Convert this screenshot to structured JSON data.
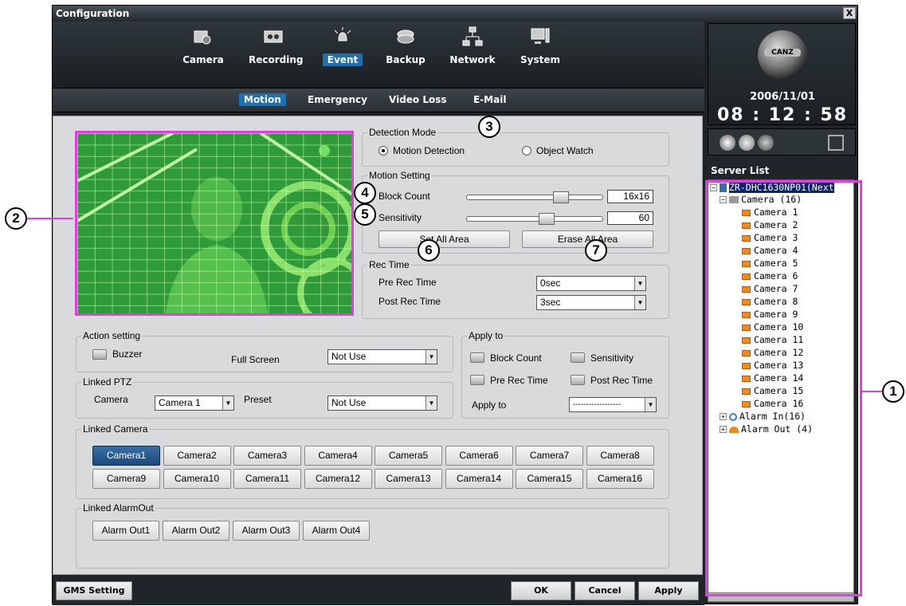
{
  "window": {
    "title": "Configuration",
    "close": "X"
  },
  "nav": {
    "items": [
      {
        "label": "Camera",
        "icon": "camera-icon"
      },
      {
        "label": "Recording",
        "icon": "recorder-icon"
      },
      {
        "label": "Event",
        "icon": "alarm-bell-icon"
      },
      {
        "label": "Backup",
        "icon": "disc-icon"
      },
      {
        "label": "Network",
        "icon": "network-icon"
      },
      {
        "label": "System",
        "icon": "monitor-icon"
      }
    ],
    "active": "Event"
  },
  "subnav": {
    "items": [
      "Motion",
      "Emergency",
      "Video Loss",
      "E-Mail"
    ],
    "active": "Motion"
  },
  "brand": {
    "logo": "CANZ",
    "date": "2006/11/01",
    "time": "08 : 12 : 58"
  },
  "server_list": {
    "header": "Server List",
    "root": "ZR-DHC1630NP01(Next",
    "camera_group": "Camera (16)",
    "cameras": [
      "Camera 1",
      "Camera 2",
      "Camera 3",
      "Camera 4",
      "Camera 5",
      "Camera 6",
      "Camera 7",
      "Camera 8",
      "Camera 9",
      "Camera 10",
      "Camera 11",
      "Camera 12",
      "Camera 13",
      "Camera 14",
      "Camera 15",
      "Camera 16"
    ],
    "alarm_in": "Alarm In(16)",
    "alarm_out": "Alarm Out (4)"
  },
  "detection_mode": {
    "label": "Detection Mode",
    "option1": "Motion Detection",
    "option2": "Object Watch",
    "selected": "Motion Detection"
  },
  "motion_setting": {
    "label": "Motion Setting",
    "block_count_label": "Block Count",
    "block_count_value": "16x16",
    "block_count_level": 0.72,
    "sensitivity_label": "Sensitivity",
    "sensitivity_value": "60",
    "sensitivity_level": 0.6,
    "set_all": "Set All Area",
    "erase_all": "Erase All Area"
  },
  "rec_time": {
    "label": "Rec Time",
    "pre_label": "Pre Rec Time",
    "pre_value": "0sec",
    "post_label": "Post Rec Time",
    "post_value": "3sec"
  },
  "action_setting": {
    "label": "Action setting",
    "buzzer": "Buzzer",
    "full_screen_label": "Full Screen",
    "full_screen_value": "Not Use"
  },
  "linked_ptz": {
    "label": "Linked PTZ",
    "camera_label": "Camera",
    "camera_value": "Camera 1",
    "preset_label": "Preset",
    "preset_value": "Not Use"
  },
  "apply_to": {
    "label": "Apply to",
    "block_count": "Block Count",
    "sensitivity": "Sensitivity",
    "pre_rec": "Pre Rec Time",
    "post_rec": "Post Rec Time",
    "apply_to_label": "Apply to",
    "apply_to_value": "------------------"
  },
  "linked_camera": {
    "label": "Linked Camera",
    "buttons": [
      "Camera1",
      "Camera2",
      "Camera3",
      "Camera4",
      "Camera5",
      "Camera6",
      "Camera7",
      "Camera8",
      "Camera9",
      "Camera10",
      "Camera11",
      "Camera12",
      "Camera13",
      "Camera14",
      "Camera15",
      "Camera16"
    ],
    "selected": "Camera1"
  },
  "linked_alarmout": {
    "label": "Linked AlarmOut",
    "buttons": [
      "Alarm Out1",
      "Alarm Out2",
      "Alarm Out3",
      "Alarm Out4"
    ]
  },
  "footer": {
    "gms": "GMS Setting",
    "ok": "OK",
    "cancel": "Cancel",
    "apply": "Apply"
  },
  "callouts": [
    "1",
    "2",
    "3",
    "4",
    "5",
    "6",
    "7"
  ],
  "colors": {
    "highlight": "#e43ce4",
    "active_tab": "#1e6fb0",
    "preview_green": "#2e9a3a"
  }
}
